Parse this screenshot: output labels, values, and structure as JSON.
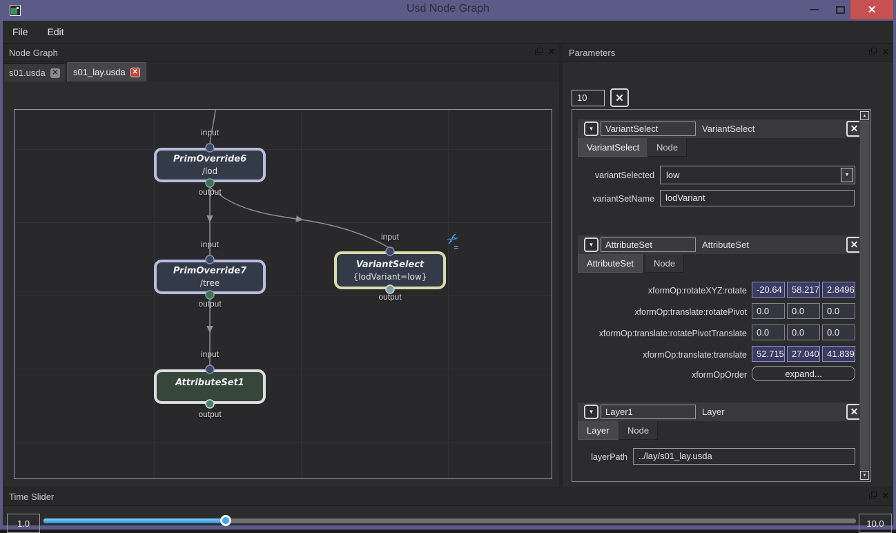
{
  "window": {
    "title": "Usd Node Graph"
  },
  "menubar": {
    "items": [
      {
        "label": "File"
      },
      {
        "label": "Edit"
      }
    ]
  },
  "icons": {
    "close_x": "✕",
    "collapse_arrow": "▼",
    "combo_arrow": "▼",
    "scroll_up": "▲",
    "scroll_down": "▼"
  },
  "node_graph": {
    "dock_title": "Node Graph",
    "tabs": [
      {
        "label": "s01.usda"
      },
      {
        "label": "s01_lay.usda"
      }
    ],
    "port_labels": {
      "input": "input",
      "output": "output"
    },
    "nodes": [
      {
        "title": "PrimOverride6",
        "subtitle": "/lod"
      },
      {
        "title": "PrimOverride7",
        "subtitle": "/tree"
      },
      {
        "title": "AttributeSet1",
        "subtitle": ""
      },
      {
        "title": "VariantSelect",
        "subtitle": "{lodVariant=low}"
      }
    ]
  },
  "parameters": {
    "dock_title": "Parameters",
    "filter_value": "10",
    "groups": [
      {
        "name": "VariantSelect",
        "type": "VariantSelect",
        "tabs": [
          "VariantSelect",
          "Node"
        ],
        "rows": [
          {
            "label": "variantSelected",
            "value": "low"
          },
          {
            "label": "variantSetName",
            "value": "lodVariant"
          }
        ]
      },
      {
        "name": "AttributeSet",
        "type": "AttributeSet",
        "tabs": [
          "AttributeSet",
          "Node"
        ],
        "rows": [
          {
            "label": "xformOp:rotateXYZ:rotate",
            "values": [
              "-20.64",
              "58.217",
              "2.8496"
            ],
            "highlighted": true
          },
          {
            "label": "xformOp:translate:rotatePivot",
            "values": [
              "0.0",
              "0.0",
              "0.0"
            ],
            "highlighted": false
          },
          {
            "label": "xformOp:translate:rotatePivotTranslate",
            "values": [
              "0.0",
              "0.0",
              "0.0"
            ],
            "highlighted": false
          },
          {
            "label": "xformOp:translate:translate",
            "values": [
              "52.715",
              "27.040",
              "41.839"
            ],
            "highlighted": true
          },
          {
            "label": "xformOpOrder",
            "button": "expand..."
          }
        ]
      },
      {
        "name": "Layer1",
        "type": "Layer",
        "tabs": [
          "Layer",
          "Node"
        ],
        "rows": [
          {
            "label": "layerPath",
            "value": "../lay/s01_lay.usda"
          }
        ]
      }
    ]
  },
  "time_slider": {
    "dock_title": "Time Slider",
    "start_value": "1.0",
    "end_value": "10.0"
  },
  "colors": {
    "titlebar": "#5c5a86",
    "close_button": "#c75050",
    "canvas_bg": "#29292b",
    "prim_node_border": "#b9bcdd",
    "attr_node_border": "#dcdcdc",
    "variant_node_border": "#d9dbaa",
    "attr_node_fill": "#37463b",
    "prim_node_fill": "#333b48",
    "highlight_field_bg": "#3b3b63",
    "slider_blue": "#2191d8"
  }
}
